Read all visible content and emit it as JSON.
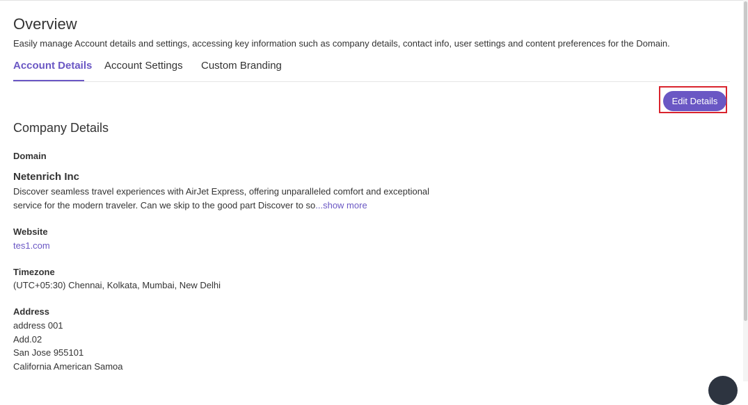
{
  "header": {
    "title": "Overview",
    "subtitle": "Easily manage Account details and settings, accessing key information such as company details, contact info, user settings and content preferences for the Domain."
  },
  "tabs": [
    {
      "label": "Account Details",
      "active": true
    },
    {
      "label": "Account Settings",
      "active": false
    },
    {
      "label": "Custom Branding",
      "active": false
    }
  ],
  "actions": {
    "edit_label": "Edit Details"
  },
  "company": {
    "section_title": "Company Details",
    "domain_label": "Domain",
    "name": "Netenrich Inc",
    "description_line1": "Discover seamless travel experiences with AirJet Express, offering unparalleled comfort and exceptional",
    "description_line2": "service for the modern traveler. Can we skip to the good part Discover to so",
    "show_more": "...show more",
    "website_label": "Website",
    "website": "tes1.com",
    "timezone_label": "Timezone",
    "timezone": "(UTC+05:30) Chennai, Kolkata, Mumbai, New Delhi",
    "address_label": "Address",
    "address_lines": [
      "address 001",
      "Add.02",
      "San Jose 955101",
      "California American Samoa"
    ]
  },
  "colors": {
    "accent": "#6a57c4",
    "highlight": "#d9232d",
    "text": "#333333"
  }
}
